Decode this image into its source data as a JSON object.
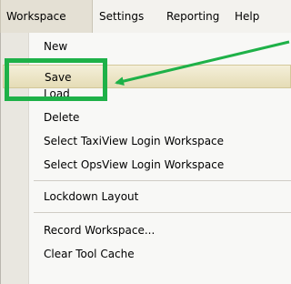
{
  "menubar": {
    "items": [
      {
        "label": "Workspace"
      },
      {
        "label": "Settings"
      },
      {
        "label": "Reporting"
      },
      {
        "label": "Help"
      }
    ]
  },
  "dropdown": {
    "items": [
      {
        "label": "New"
      },
      {
        "label": "Save"
      },
      {
        "label": "Load"
      },
      {
        "label": "Delete"
      },
      {
        "label": "Select TaxiView Login Workspace"
      },
      {
        "label": "Select OpsView Login Workspace"
      },
      {
        "label": "Lockdown Layout"
      },
      {
        "label": "Record Workspace..."
      },
      {
        "label": "Clear Tool Cache"
      }
    ]
  },
  "highlight_color": "#1eb148"
}
